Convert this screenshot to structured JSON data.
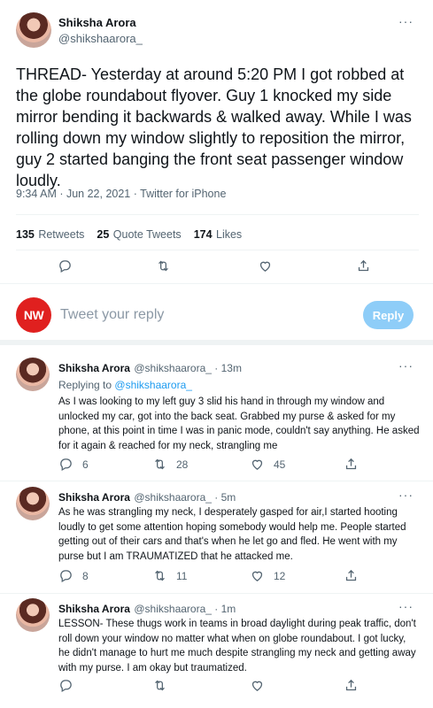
{
  "main_tweet": {
    "name": "Shiksha Arora",
    "handle": "@shikshaarora_",
    "more": "···",
    "text": "THREAD- Yesterday at around 5:20 PM I got robbed at the globe roundabout flyover. Guy 1 knocked my side mirror bending it backwards & walked away. While I was rolling down my window slightly to reposition the mirror, guy 2 started banging the front seat passenger window loudly.",
    "timestamp": "9:34 AM · Jun 22, 2021 · Twitter for iPhone",
    "stats": {
      "retweets_count": "135",
      "retweets_label": "Retweets",
      "quotes_count": "25",
      "quotes_label": "Quote Tweets",
      "likes_count": "174",
      "likes_label": "Likes"
    }
  },
  "compose": {
    "avatar_text": "NW",
    "avatar_color": "#e0201f",
    "placeholder": "Tweet your reply",
    "button": "Reply",
    "button_color": "#8ecdf8"
  },
  "replies": [
    {
      "name": "Shiksha Arora",
      "handle": "@shikshaarora_ · 13m",
      "replying_prefix": "Replying to",
      "replying_to": "@shikshaarora_",
      "text": "As I was looking to my left guy 3 slid his hand in through my window and unlocked my car, got into the back seat. Grabbed my purse & asked for my phone, at this point in time I was in panic mode, couldn't say anything. He asked for it again & reached for my neck, strangling me",
      "replies": "6",
      "retweets": "28",
      "likes": "45"
    },
    {
      "name": "Shiksha Arora",
      "handle": "@shikshaarora_ · 5m",
      "text": "As he was strangling my neck, I desperately gasped for air,I started hooting loudly to get some attention hoping somebody would help me. People started getting out of their cars and that's when he let go and fled. He went with my purse but I am TRAUMATIZED that he attacked me.",
      "replies": "8",
      "retweets": "11",
      "likes": "12"
    },
    {
      "name": "Shiksha Arora",
      "handle": "@shikshaarora_ · 1m",
      "text": "LESSON- These thugs work in teams in broad daylight during peak traffic, don't roll down your window no matter what when on globe roundabout. I got lucky, he didn't manage to hurt me much despite strangling my neck and getting away with my purse. I am okay but traumatized."
    }
  ],
  "icons": {
    "reply": "reply-icon",
    "retweet": "retweet-icon",
    "like": "heart-icon",
    "share": "share-icon"
  },
  "accent_color": "#1d9bf0"
}
